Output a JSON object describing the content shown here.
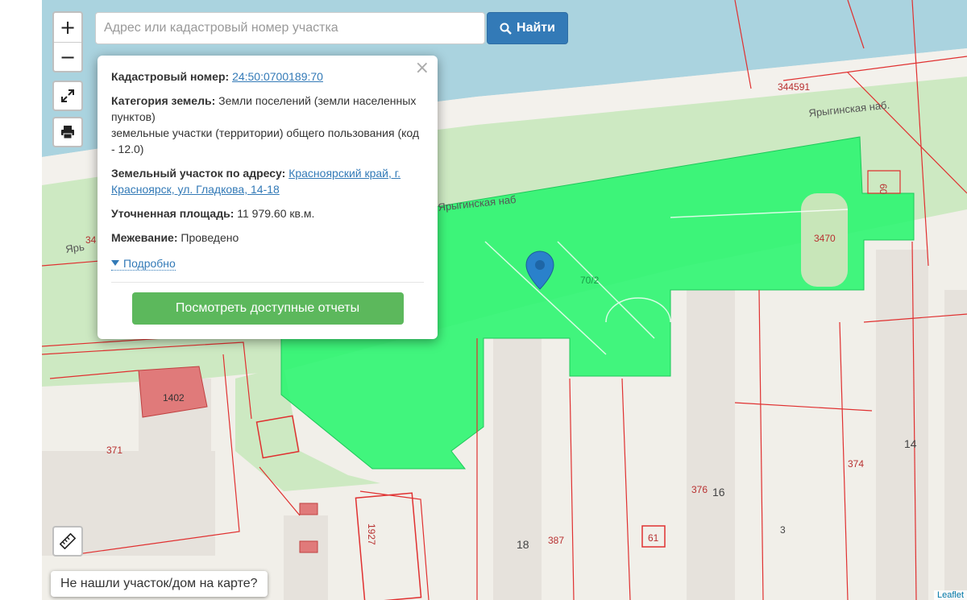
{
  "search": {
    "placeholder": "Адрес или кадастровый номер участка",
    "button_label": "Найти"
  },
  "zoom": {
    "in": "+",
    "out": "−"
  },
  "icons": {
    "fullscreen": "expand-icon",
    "print": "print-icon",
    "ruler": "ruler-icon",
    "marker": "map-marker-icon",
    "search": "search-icon"
  },
  "popup": {
    "cadastral_label": "Кадастровый номер:",
    "cadastral_value": "24:50:0700189:70",
    "category_label": "Категория земель:",
    "category_value_1": "Земли поселений (земли населенных пунктов)",
    "category_value_2": "земельные участки (территории) общего пользования (код - 12.0)",
    "address_label": "Земельный участок по адресу:",
    "address_value": "Красноярский край, г. Красноярск, ул. Гладкова, 14-18",
    "area_label": "Уточненная площадь:",
    "area_value": "11 979.60 кв.м.",
    "survey_label": "Межевание:",
    "survey_value": "Проведено",
    "more_label": "Подробно",
    "reports_button": "Посмотреть доступные отчеты"
  },
  "not_found": "Не нашли участок/дом на карте?",
  "attribution": "Leaflet",
  "map_labels": {
    "l344591": "344591",
    "street1": "Ярыгинская наб.",
    "street2": "Ярыгинская наб",
    "street3": "Ярь",
    "num34": "34",
    "l60": "60",
    "l3470": "3470",
    "l70_2": "70/2",
    "l1402": "1402",
    "l371": "371",
    "l14": "14",
    "l374": "374",
    "l376": "376",
    "l16": "16",
    "l1927": "1927",
    "l18": "18",
    "l387": "387",
    "l61": "61",
    "l3": "3"
  },
  "colors": {
    "parcel": "#2ef571",
    "water": "#aad3df",
    "park": "#c8e6b9",
    "boundary": "#e03030",
    "accent": "#337ab7",
    "report_button": "#5cb85c"
  }
}
